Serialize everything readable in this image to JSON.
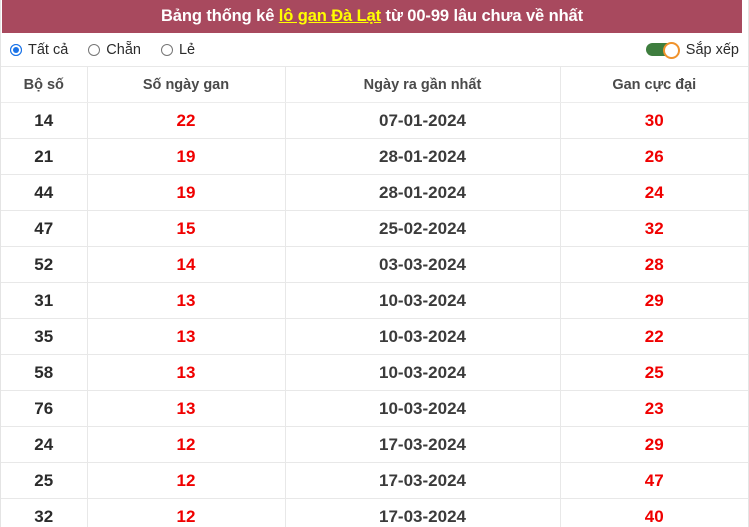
{
  "header": {
    "title_prefix": "Bảng thống kê ",
    "title_highlight": "lô gan Đà Lạt",
    "title_suffix": " từ 00-99 lâu chưa về nhất",
    "bar_color": "#a8495e",
    "highlight_color": "#ffff00"
  },
  "filters": {
    "radios": [
      {
        "label": "Tất cả",
        "selected": true
      },
      {
        "label": "Chẵn",
        "selected": false
      },
      {
        "label": "Lẻ",
        "selected": false
      }
    ],
    "sort_toggle": {
      "label": "Sắp xếp",
      "state": "on",
      "track_color": "#3e7d3e",
      "knob_color": "#f0922b"
    }
  },
  "table": {
    "columns": [
      "Bộ số",
      "Số ngày gan",
      "Ngày ra gần nhất",
      "Gan cực đại"
    ],
    "rows": [
      {
        "bo_so": "14",
        "so_ngay_gan": "22",
        "ngay_ra": "07-01-2024",
        "gan_cuc_dai": "30"
      },
      {
        "bo_so": "21",
        "so_ngay_gan": "19",
        "ngay_ra": "28-01-2024",
        "gan_cuc_dai": "26"
      },
      {
        "bo_so": "44",
        "so_ngay_gan": "19",
        "ngay_ra": "28-01-2024",
        "gan_cuc_dai": "24"
      },
      {
        "bo_so": "47",
        "so_ngay_gan": "15",
        "ngay_ra": "25-02-2024",
        "gan_cuc_dai": "32"
      },
      {
        "bo_so": "52",
        "so_ngay_gan": "14",
        "ngay_ra": "03-03-2024",
        "gan_cuc_dai": "28"
      },
      {
        "bo_so": "31",
        "so_ngay_gan": "13",
        "ngay_ra": "10-03-2024",
        "gan_cuc_dai": "29"
      },
      {
        "bo_so": "35",
        "so_ngay_gan": "13",
        "ngay_ra": "10-03-2024",
        "gan_cuc_dai": "22"
      },
      {
        "bo_so": "58",
        "so_ngay_gan": "13",
        "ngay_ra": "10-03-2024",
        "gan_cuc_dai": "25"
      },
      {
        "bo_so": "76",
        "so_ngay_gan": "13",
        "ngay_ra": "10-03-2024",
        "gan_cuc_dai": "23"
      },
      {
        "bo_so": "24",
        "so_ngay_gan": "12",
        "ngay_ra": "17-03-2024",
        "gan_cuc_dai": "29"
      },
      {
        "bo_so": "25",
        "so_ngay_gan": "12",
        "ngay_ra": "17-03-2024",
        "gan_cuc_dai": "47"
      },
      {
        "bo_so": "32",
        "so_ngay_gan": "12",
        "ngay_ra": "17-03-2024",
        "gan_cuc_dai": "40"
      }
    ]
  }
}
